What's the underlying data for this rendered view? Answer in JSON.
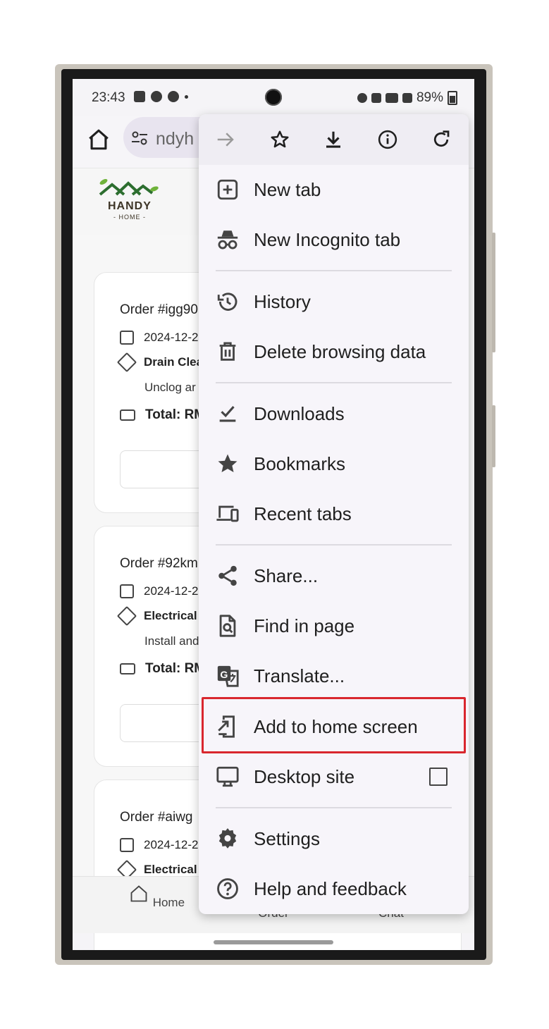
{
  "status": {
    "time": "23:43",
    "battery": "89%"
  },
  "url": {
    "text": "ndyh"
  },
  "site": {
    "logo_title": "HANDY",
    "logo_sub": "- HOME -"
  },
  "orders": [
    {
      "title": "Order #igg90",
      "date": "2024-12-2",
      "service": "Drain Clea",
      "desc": "Unclog ar",
      "total": "Total: RM"
    },
    {
      "title": "Order #92km",
      "date": "2024-12-2",
      "service": "Electrical",
      "desc": "Install and",
      "total": "Total: RM"
    },
    {
      "title": "Order #aiwg",
      "date": "2024-12-2",
      "service": "Electrical"
    }
  ],
  "bottom_nav": {
    "home": "Home",
    "order": "Order",
    "chat": "Chat"
  },
  "menu": {
    "top_icons": [
      "forward-arrow-icon",
      "star-icon",
      "download-icon",
      "info-icon",
      "refresh-icon"
    ],
    "new_tab": "New tab",
    "new_incognito_tab": "New Incognito tab",
    "history": "History",
    "delete_browsing_data": "Delete browsing data",
    "downloads": "Downloads",
    "bookmarks": "Bookmarks",
    "recent_tabs": "Recent tabs",
    "share": "Share...",
    "find_in_page": "Find in page",
    "translate": "Translate...",
    "add_to_home_screen": "Add to home screen",
    "desktop_site": "Desktop site",
    "desktop_site_checked": false,
    "settings": "Settings",
    "help_and_feedback": "Help and feedback"
  },
  "highlight_color": "#d9272e"
}
